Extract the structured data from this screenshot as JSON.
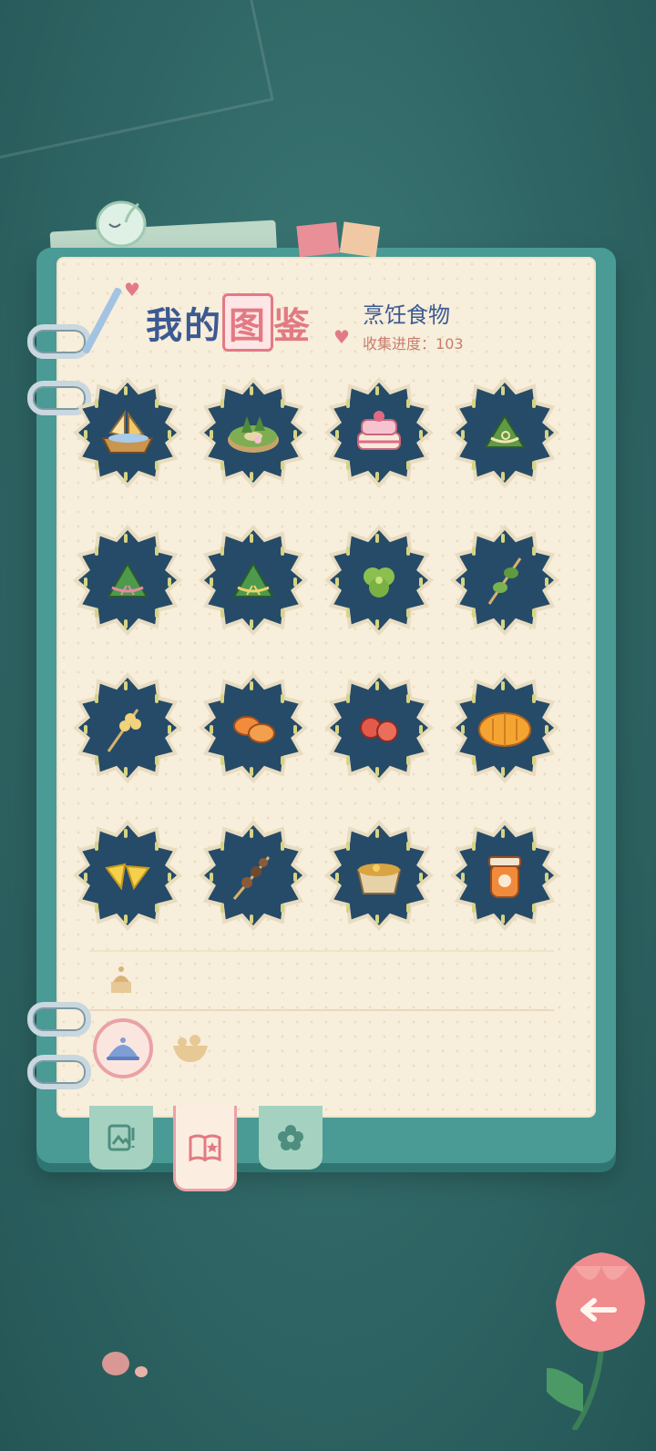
{
  "header": {
    "title_part1": "我的",
    "title_part2": "图",
    "title_part3": "鉴",
    "category": "烹饪食物",
    "progress_label": "收集进度：",
    "progress_value": "103"
  },
  "items": [
    {
      "icon": "boat-cake-icon"
    },
    {
      "icon": "matcha-wreath-cake-icon"
    },
    {
      "icon": "pink-layer-cake-icon"
    },
    {
      "icon": "zongzi-icon"
    },
    {
      "icon": "zongzi-pink-ribbon-icon"
    },
    {
      "icon": "zongzi-yellow-ribbon-icon"
    },
    {
      "icon": "green-flower-cake-icon"
    },
    {
      "icon": "vegetable-skewer-icon"
    },
    {
      "icon": "corn-skewer-icon"
    },
    {
      "icon": "orange-cookies-icon"
    },
    {
      "icon": "red-flower-cookies-icon"
    },
    {
      "icon": "pumpkin-cake-icon"
    },
    {
      "icon": "cheese-slices-icon"
    },
    {
      "icon": "mushroom-skewer-icon"
    },
    {
      "icon": "soup-bowl-icon"
    },
    {
      "icon": "jam-jar-icon"
    }
  ],
  "colors": {
    "accent_pink": "#e27a84",
    "title_blue": "#3c5a92",
    "badge_navy": "#264b68",
    "background_teal": "#2f6665"
  }
}
